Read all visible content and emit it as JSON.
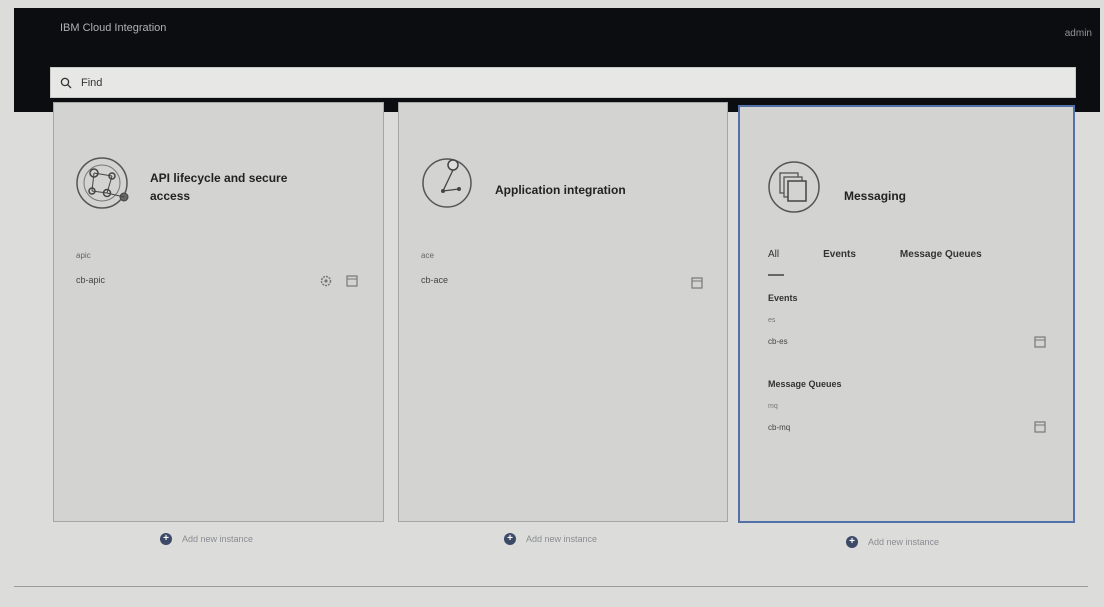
{
  "header": {
    "brand": "IBM Cloud Integration",
    "user": "admin"
  },
  "search": {
    "placeholder": "Find"
  },
  "cards": [
    {
      "title_line1": "API lifecycle and secure",
      "title_line2": "access",
      "instance_label": "apic",
      "instance_name": "cb-apic"
    },
    {
      "title": "Application integration",
      "instance_label": "ace",
      "instance_name": "cb-ace"
    },
    {
      "title": "Messaging",
      "tabs": [
        "All",
        "Events",
        "Message Queues"
      ],
      "events": {
        "title": "Events",
        "sub": "es",
        "name": "cb-es"
      },
      "queues": {
        "title": "Message Queues",
        "sub": "mq",
        "name": "cb-mq"
      }
    }
  ],
  "add_instance_label": "Add new instance",
  "colors": {
    "header_bg": "#0c0d10",
    "page_bg": "#dcdcda",
    "selected_border": "#5271a8"
  }
}
